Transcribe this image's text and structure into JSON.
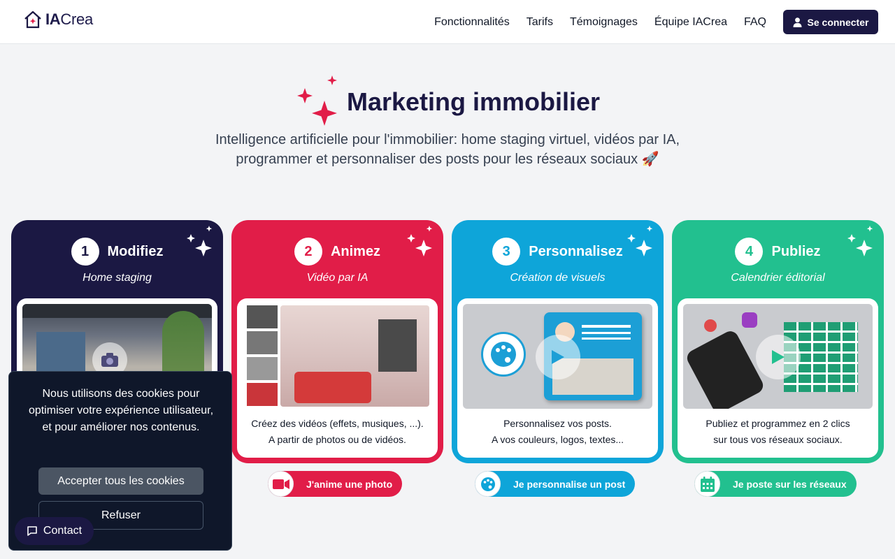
{
  "brand": {
    "name_bold": "IA",
    "name_rest": "Crea"
  },
  "nav": {
    "links": [
      "Fonctionnalités",
      "Tarifs",
      "Témoignages",
      "Équipe IACrea",
      "FAQ"
    ],
    "login_label": "Se connecter"
  },
  "hero": {
    "title": "Marketing immobilier",
    "subtitle_line1": "Intelligence artificielle pour l'immobilier: home staging virtuel, vidéos par IA,",
    "subtitle_line2": "programmer et personnaliser des posts pour les réseaux sociaux 🚀"
  },
  "cards": [
    {
      "number": "1",
      "title": "Modifiez",
      "subtitle": "Home staging",
      "text_line1": "",
      "text_line2": ""
    },
    {
      "number": "2",
      "title": "Animez",
      "subtitle": "Vidéo par IA",
      "text_line1": "Créez des vidéos (effets, musiques, ...).",
      "text_line2": "A partir de photos ou de vidéos."
    },
    {
      "number": "3",
      "title": "Personnalisez",
      "subtitle": "Création de visuels",
      "text_line1": "Personnalisez vos posts.",
      "text_line2": "A vos couleurs, logos, textes..."
    },
    {
      "number": "4",
      "title": "Publiez",
      "subtitle": "Calendrier éditorial",
      "text_line1": "Publiez et programmez en 2 clics",
      "text_line2": "sur tous vos réseaux sociaux."
    }
  ],
  "actions": {
    "animate": "J'anime une photo",
    "customize": "Je personnalise un post",
    "publish": "Je poste sur les réseaux"
  },
  "cookie": {
    "message": "Nous utilisons des cookies pour optimiser votre expérience utilisateur, et pour améliorer nos contenus.",
    "accept": "Accepter tous les cookies",
    "refuse": "Refuser"
  },
  "contact": {
    "label": "Contact"
  },
  "colors": {
    "navy": "#1b1843",
    "red": "#e11d48",
    "blue": "#0ea5d9",
    "green": "#22c08f"
  },
  "icons": [
    "home-logo-icon",
    "user-icon",
    "sparkle-icon",
    "camera-icon",
    "play-icon",
    "video-camera-icon",
    "palette-icon",
    "calendar-icon",
    "chat-icon"
  ]
}
